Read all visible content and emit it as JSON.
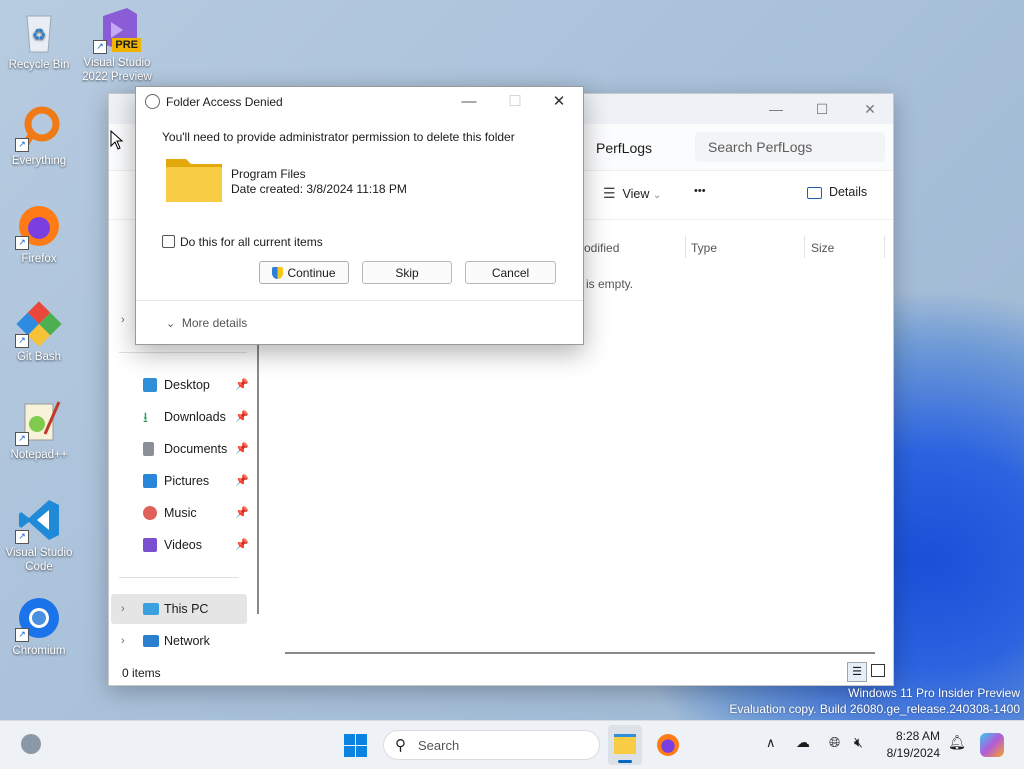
{
  "desktop": {
    "icons": [
      {
        "label": "Recycle Bin",
        "icon": "recycle-bin-icon"
      },
      {
        "label": "Visual Studio 2022 Preview",
        "badge": "PRE",
        "icon": "visual-studio-icon"
      },
      {
        "label": "Everything",
        "icon": "everything-icon"
      },
      {
        "label": "Firefox",
        "icon": "firefox-icon"
      },
      {
        "label": "Git Bash",
        "icon": "git-bash-icon"
      },
      {
        "label": "Notepad++",
        "icon": "notepadpp-icon"
      },
      {
        "label": "Visual Studio Code",
        "icon": "vscode-icon"
      },
      {
        "label": "Chromium",
        "icon": "chromium-icon"
      }
    ],
    "watermark_line1": "Windows 11 Pro Insider Preview",
    "watermark_line2": "Evaluation copy. Build 26080.ge_release.240308-1400"
  },
  "explorer": {
    "breadcrumb": "PerfLogs",
    "search_placeholder": "Search PerfLogs",
    "cmd": {
      "view_label": "View",
      "more_label": "•••",
      "details_label": "Details"
    },
    "columns": {
      "modified": "odified",
      "type": "Type",
      "size": "Size"
    },
    "empty_message": "is empty.",
    "sidebar": [
      {
        "label": "Desktop",
        "color": "#2f8fd8"
      },
      {
        "label": "Downloads",
        "color": "#2a9d5b"
      },
      {
        "label": "Documents",
        "color": "#8a8f98"
      },
      {
        "label": "Pictures",
        "color": "#2a86d8"
      },
      {
        "label": "Music",
        "color": "#e0605a"
      },
      {
        "label": "Videos",
        "color": "#7a4fd0"
      }
    ],
    "this_pc": "This PC",
    "network": "Network",
    "status_items": "0 items"
  },
  "dialog": {
    "title": "Folder Access Denied",
    "message": "You'll need to provide administrator permission to delete this folder",
    "folder_name": "Program Files",
    "date_created": "Date created: 3/8/2024 11:18 PM",
    "checkbox_label": "Do this for all current items",
    "continue_label": "Continue",
    "skip_label": "Skip",
    "cancel_label": "Cancel",
    "more_details": "More details"
  },
  "taskbar": {
    "search_label": "Search",
    "time": "8:28 AM",
    "date": "8/19/2024"
  },
  "colors": {
    "accent": "#0067c0",
    "folder": "#f8cc45"
  }
}
